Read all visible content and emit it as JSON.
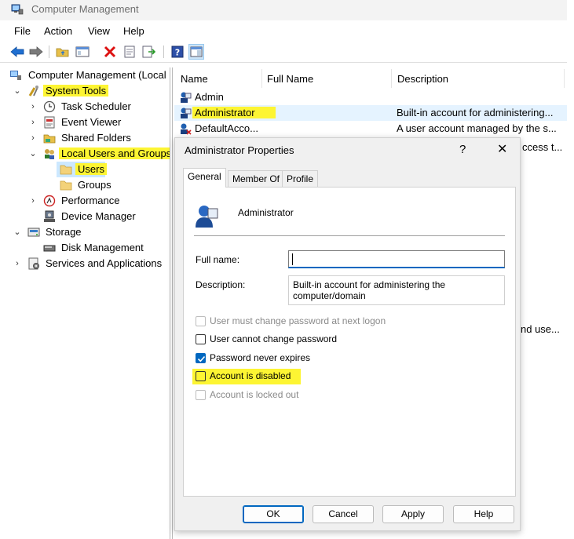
{
  "window": {
    "title": "Computer Management"
  },
  "menu": [
    "File",
    "Action",
    "View",
    "Help"
  ],
  "tree": {
    "root": "Computer Management (Local",
    "system_tools": "System Tools",
    "task_scheduler": "Task Scheduler",
    "event_viewer": "Event Viewer",
    "shared_folders": "Shared Folders",
    "local_users": "Local Users and Groups",
    "users": "Users",
    "groups": "Groups",
    "performance": "Performance",
    "device_manager": "Device Manager",
    "storage": "Storage",
    "disk_management": "Disk Management",
    "services": "Services and Applications"
  },
  "list": {
    "columns": [
      "Name",
      "Full Name",
      "Description"
    ],
    "rows": [
      {
        "name": "Admin",
        "description": ""
      },
      {
        "name": "Administrator",
        "description": "Built-in account for administering..."
      },
      {
        "name": "DefaultAcco...",
        "description": "A user account managed by the s..."
      }
    ],
    "partial_texts": [
      "ccess t...",
      "nd use..."
    ]
  },
  "dialog": {
    "title": "Administrator Properties",
    "help_glyph": "?",
    "close_glyph": "✕",
    "tabs": [
      "General",
      "Member Of",
      "Profile"
    ],
    "username": "Administrator",
    "full_name_label": "Full name:",
    "full_name_value": "",
    "description_label": "Description:",
    "description_value": "Built-in account for administering the computer/domain",
    "checkboxes": {
      "must_change": {
        "label": "User must change password at next logon",
        "checked": false,
        "enabled": false
      },
      "cannot_change": {
        "label": "User cannot change password",
        "checked": false,
        "enabled": true
      },
      "never_expires": {
        "label": "Password never expires",
        "checked": true,
        "enabled": true
      },
      "disabled": {
        "label": "Account is disabled",
        "checked": false,
        "enabled": true
      },
      "locked_out": {
        "label": "Account is locked out",
        "checked": false,
        "enabled": false
      }
    },
    "buttons": {
      "ok": "OK",
      "cancel": "Cancel",
      "apply": "Apply",
      "help": "Help"
    }
  },
  "colors": {
    "highlight": "#fdf533",
    "accent": "#0067c0",
    "selection": "#cce8ff"
  }
}
